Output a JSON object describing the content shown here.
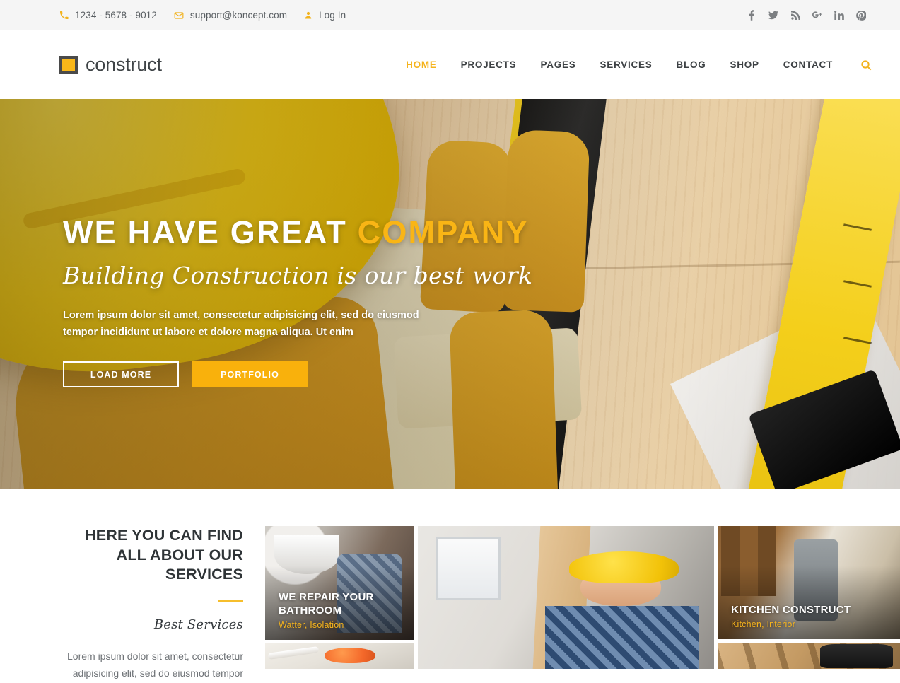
{
  "topbar": {
    "phone": {
      "icon": "phone-icon",
      "text": "1234 - 5678 - 9012"
    },
    "email": {
      "icon": "mail-icon",
      "text": "support@koncept.com"
    },
    "login": {
      "icon": "user-icon",
      "text": "Log In"
    },
    "social": [
      {
        "name": "facebook-icon",
        "glyph": "f"
      },
      {
        "name": "twitter-icon",
        "glyph": "🐦"
      },
      {
        "name": "rss-icon",
        "glyph": "rss"
      },
      {
        "name": "google-plus-icon",
        "glyph": "g+"
      },
      {
        "name": "linkedin-icon",
        "glyph": "in"
      },
      {
        "name": "pinterest-icon",
        "glyph": "p"
      }
    ]
  },
  "header": {
    "logo_text": "construct",
    "nav": [
      {
        "label": "HOME",
        "active": true
      },
      {
        "label": "PROJECTS",
        "active": false
      },
      {
        "label": "PAGES",
        "active": false
      },
      {
        "label": "SERVICES",
        "active": false
      },
      {
        "label": "BLOG",
        "active": false
      },
      {
        "label": "SHOP",
        "active": false
      },
      {
        "label": "CONTACT",
        "active": false
      }
    ],
    "search_icon": "search-icon"
  },
  "hero": {
    "title_main": "WE HAVE GREAT ",
    "title_highlight": "COMPANY",
    "subtitle": "Building Construction is our best work",
    "paragraph": "Lorem ipsum dolor sit amet, consectetur adipisicing elit, sed do eiusmod tempor incididunt ut labore et dolore magna aliqua. Ut enim",
    "btn_primary": "LOAD MORE",
    "btn_secondary": "PORTFOLIO"
  },
  "services": {
    "title": "HERE YOU CAN FIND ALL ABOUT OUR SERVICES",
    "script": "Best Services",
    "paragraph": "Lorem ipsum dolor sit amet, consectetur adipisicing elit, sed do eiusmod tempor",
    "gallery": [
      {
        "id": "bathroom",
        "title": "WE REPAIR YOUR BATHROOM",
        "tags": "Watter, Isolation"
      },
      {
        "id": "paint",
        "title": "",
        "tags": ""
      },
      {
        "id": "carpenter",
        "title": "",
        "tags": ""
      },
      {
        "id": "kitchen",
        "title": "KITCHEN CONSTRUCT",
        "tags": "Kitchen, Interior"
      },
      {
        "id": "frame",
        "title": "",
        "tags": ""
      }
    ]
  },
  "colors": {
    "accent": "#f9b10c",
    "accent_text": "#f5b31c",
    "dark_text": "#2f3437",
    "muted_text": "#6f7377",
    "topbar_bg": "#f5f5f5"
  }
}
